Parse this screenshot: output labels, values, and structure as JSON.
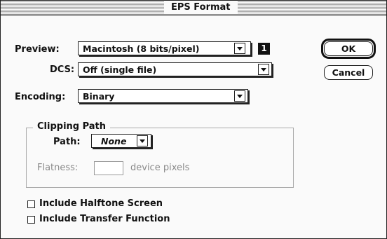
{
  "dialog": {
    "title": "EPS Format"
  },
  "preview": {
    "label": "Preview:",
    "value": "Macintosh (8 bits/pixel)",
    "badge": "1"
  },
  "dcs": {
    "label": "DCS:",
    "value": "Off (single file)"
  },
  "encoding": {
    "label": "Encoding:",
    "value": "Binary"
  },
  "clipping": {
    "group_title": "Clipping Path",
    "path_label": "Path:",
    "path_value": "None",
    "flatness_label": "Flatness:",
    "flatness_value": "",
    "flatness_unit": "device pixels"
  },
  "checkboxes": {
    "halftone": {
      "label": "Include Halftone Screen",
      "checked": false
    },
    "transfer": {
      "label": "Include Transfer Function",
      "checked": false
    }
  },
  "buttons": {
    "ok": "OK",
    "cancel": "Cancel"
  }
}
